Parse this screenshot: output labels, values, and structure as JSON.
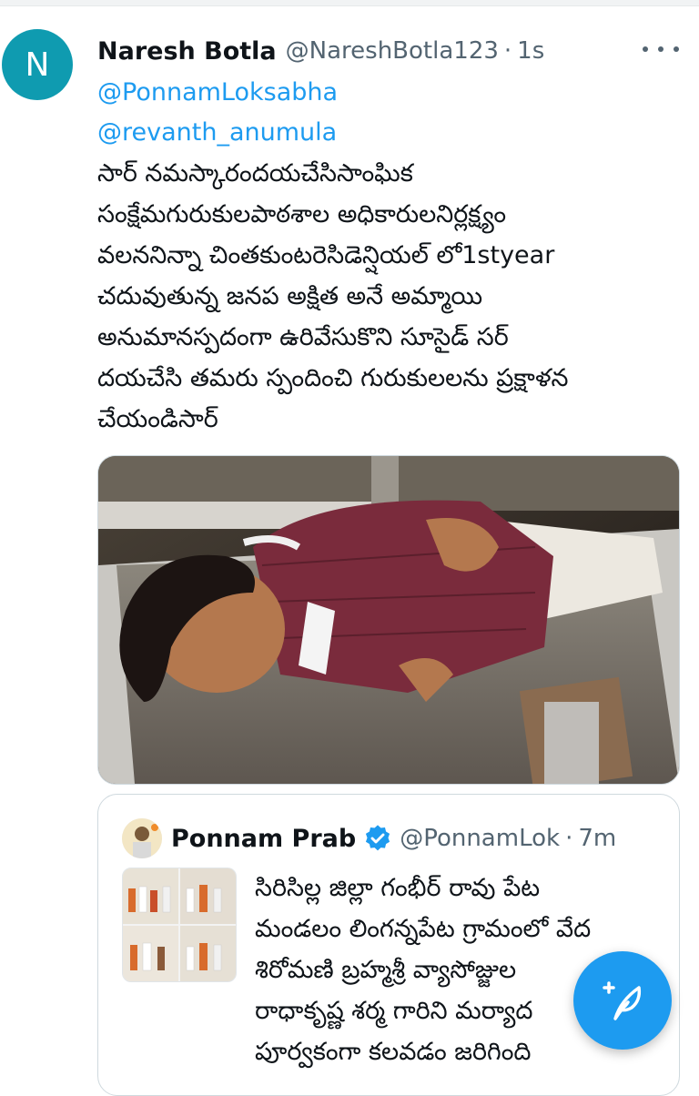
{
  "tweet": {
    "avatar_letter": "N",
    "display_name": "Naresh Botla",
    "handle": "@NareshBotla123",
    "separator": "·",
    "time": "1s",
    "mentions": [
      "@PonnamLoksabha",
      "@revanth_anumula"
    ],
    "text_lines": [
      "సార్ నమస్కారందయచేసిసాంఘిక",
      "సంక్షేమగురుకులపాఠశాల అధికారులనిర్లక్ష్యం",
      "వలననిన్నా చింతకుంటరెసిడెన్షియల్ లో1styear",
      "చదువుతున్న జనప అక్షిత అనే అమ్మాయి",
      "అనుమానస్పదంగా ఉరివేసుకొని సూసైడ్ సర్",
      "దయచేసి తమరు స్పందించి గురుకులలను ప్రక్షాళన",
      "చేయండిసార్"
    ],
    "media_icon": "photo-girl-on-stretcher"
  },
  "quoted_tweet": {
    "display_name": "Ponnam Prab",
    "handle": "@PonnamLok",
    "separator": "·",
    "time": "7m",
    "verified_icon": "verified-badge-icon",
    "text_lines": [
      "సిరిసిల్ల జిల్లా గంభీర్ రావు పేట",
      "మండలం  లింగన్నపేట గ్రామంలో వేద",
      "శిరోమణి బ్రహ్మశ్రీ వ్యాసోజ్జుల",
      "రాధాకృష్ణ శర్మ గారిని మర్యాద",
      "పూర్వకంగా కలవడం జరిగింది"
    ]
  },
  "fab": {
    "icon": "compose-feather-icon"
  },
  "colors": {
    "link": "#1d9bf0",
    "secondary_text": "#536471",
    "avatar_bg": "#0f9bb0",
    "fab_bg": "#1d9bf0",
    "shirt": "#7a2b3c"
  }
}
